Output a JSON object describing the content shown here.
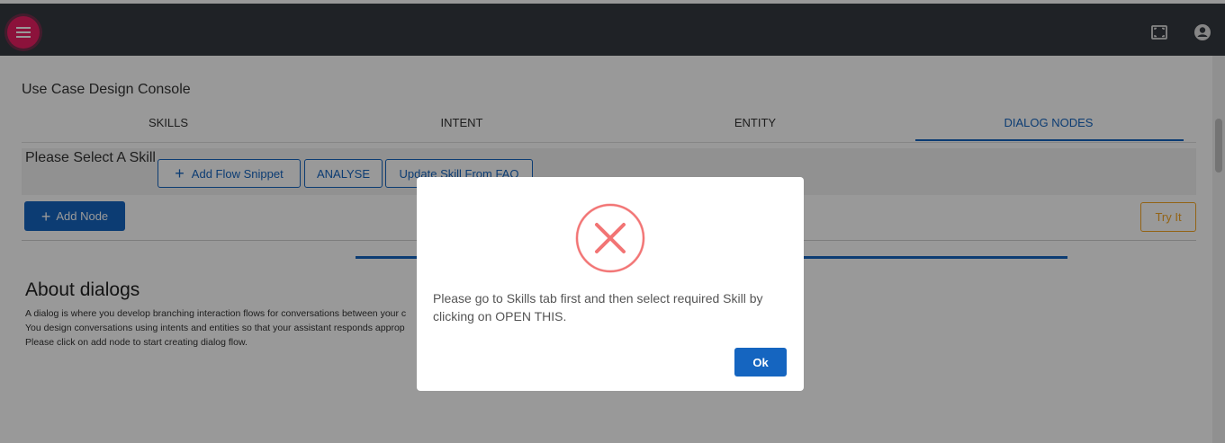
{
  "header": {
    "menu_icon": "hamburger-icon",
    "fullscreen_icon": "fullscreen-icon",
    "account_icon": "account-circle-icon"
  },
  "console": {
    "title": "Use Case Design Console",
    "tabs": [
      {
        "label": "SKILLS"
      },
      {
        "label": "INTENT"
      },
      {
        "label": "ENTITY"
      },
      {
        "label": "DIALOG NODES"
      }
    ],
    "active_tab": "DIALOG NODES"
  },
  "skill_bar": {
    "label": "Please Select A Skill",
    "add_flow_snippet": "Add Flow Snippet",
    "analyse": "ANALYSE",
    "update_skill": "Update Skill From FAQ"
  },
  "toolbar": {
    "add_node": "Add Node",
    "try_it": "Try It"
  },
  "about": {
    "title": "About dialogs",
    "lines": [
      "A dialog is where you develop branching interaction flows for conversations between your c",
      "You design conversations using intents and entities so that your assistant responds approp",
      "Please click on add node to start creating dialog flow."
    ]
  },
  "modal": {
    "icon": "error-x-icon",
    "message": "Please go to Skills tab first and then select required Skill by clicking on OPEN THIS.",
    "ok_label": "Ok"
  },
  "colors": {
    "header_bg": "#343a40",
    "menu_accent": "#e91e63",
    "primary": "#1565c0",
    "warning": "#f5a623",
    "error": "#f27474"
  }
}
